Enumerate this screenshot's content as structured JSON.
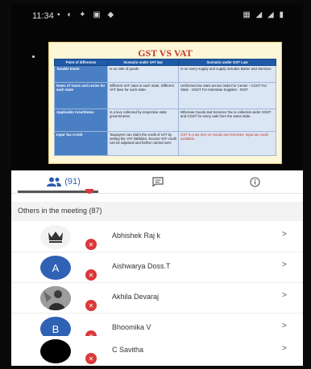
{
  "status_bar": {
    "time": "11:34"
  },
  "slide": {
    "title": "GST VS VAT",
    "headers": [
      "Point of difference",
      "Scenario under VAT law",
      "Scenario under GST Law"
    ],
    "rows": [
      [
        "Taxable Event",
        "Is on sale of goods",
        "Is on every supply and supply includes Barter and Services"
      ],
      [
        "Rates of Taxes and Levies for each state",
        "Different VAT rates in each state. Different VAT laws for each state.",
        "Uniformed tax rates across India For Center - CGST For State - SGST For Interstate Supplies - IGST"
      ],
      [
        "Applicable Area/Status",
        "Is a levy collected by respective state governments.",
        "Whereas Goods and Services Tax is collected under SGST and CGST for every sale from the same state."
      ],
      [
        "Input Tax Credit",
        "Taxpayers can claim the credit of VAT by setting the VAT liabilities. Excess VAT credit can be adjusted and further carried over.",
        "GST is a tax levy on Goods and Services. Input tax credit available."
      ]
    ]
  },
  "tabs": {
    "people_count": "(91)"
  },
  "section_title": "Others in the meeting (87)",
  "participants": [
    {
      "name": "Abhishek Raj k",
      "avatar_letter": "",
      "avatar_color": "#f2f2f2"
    },
    {
      "name": "Aishwarya Doss.T",
      "avatar_letter": "A",
      "avatar_color": "#2f61b4"
    },
    {
      "name": "Akhila Devaraj",
      "avatar_letter": "",
      "avatar_color": "#8a8a8a"
    },
    {
      "name": "Bhoomika V",
      "avatar_letter": "B",
      "avatar_color": "#2f61b4"
    },
    {
      "name": "C Savitha",
      "avatar_letter": "",
      "avatar_color": "#000000"
    }
  ],
  "icons": {
    "people": "people-icon",
    "chat": "chat-icon",
    "info": "info-icon",
    "mute": "mic-off-icon",
    "chevron": "chevron-right-icon"
  },
  "colors": {
    "accent": "#2a5cae",
    "mute_badge": "#d9383a",
    "slide_header": "#1f5aa6"
  }
}
